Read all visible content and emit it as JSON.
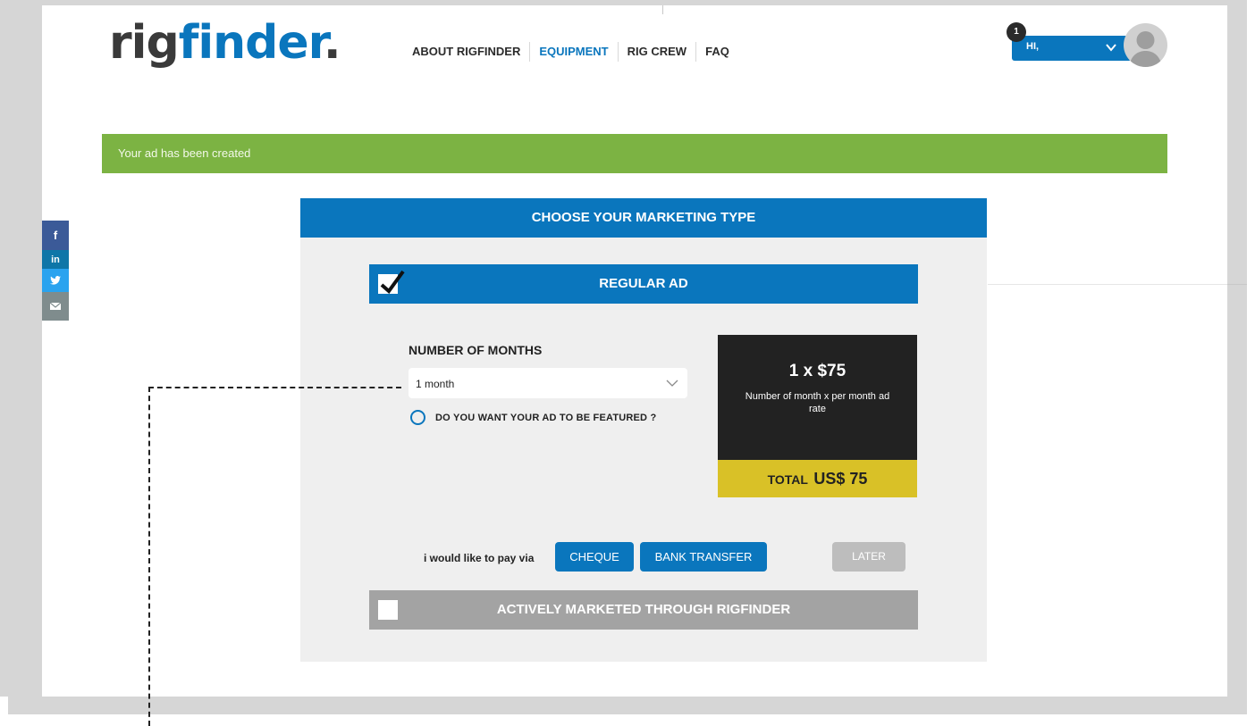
{
  "brand": {
    "logo_part1": "rig",
    "logo_part2": "finder",
    "logo_dot": "."
  },
  "nav": {
    "items": [
      "ABOUT RIGFINDER",
      "EQUIPMENT",
      "RIG CREW",
      "FAQ"
    ],
    "active": "EQUIPMENT"
  },
  "user": {
    "greeting": "HI,",
    "notifications": "1"
  },
  "alert": {
    "message": "Your ad has been created"
  },
  "social": [
    "facebook",
    "linkedin",
    "twitter",
    "email"
  ],
  "marketing": {
    "header": "CHOOSE YOUR MARKETING TYPE",
    "regular": {
      "label": "REGULAR AD",
      "checked": true,
      "months_label": "NUMBER OF MONTHS",
      "months_value": "1 month",
      "featured_question": "DO YOU WANT YOUR AD TO BE FEATURED ?",
      "price_formula": "1 x $75",
      "price_note": "Number of month x per month ad rate",
      "total_label": "TOTAL",
      "total_value": "US$ 75"
    },
    "payment": {
      "label": "i would like to pay via",
      "cheque": "CHEQUE",
      "bank_transfer": "BANK TRANSFER",
      "later": "LATER"
    },
    "actively_marketed": {
      "label": "ACTIVELY MARKETED THROUGH RIGFINDER",
      "checked": false
    }
  },
  "colors": {
    "primary": "#0a76bd",
    "success": "#7cb343",
    "total": "#d9c127",
    "dark": "#222222",
    "disabled": "#a3a3a3"
  }
}
